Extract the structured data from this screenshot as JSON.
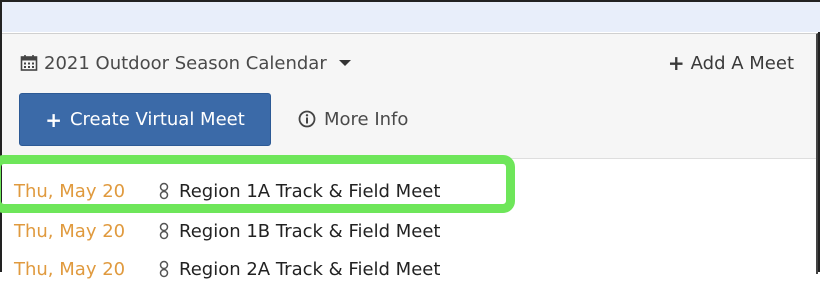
{
  "header": {
    "season_label": "2021 Outdoor Season Calendar",
    "add_meet_label": "Add A Meet",
    "create_button_label": "Create Virtual Meet",
    "more_info_label": "More Info"
  },
  "meets": [
    {
      "date": "Thu, May 20",
      "name": "Region 1A Track & Field Meet"
    },
    {
      "date": "Thu, May 20",
      "name": "Region 1B Track & Field Meet"
    },
    {
      "date": "Thu, May 20",
      "name": "Region 2A Track & Field Meet"
    }
  ],
  "colors": {
    "accent_button": "#3b6aa8",
    "date_text": "#e09a3e",
    "highlight_box": "#6ee65a"
  },
  "icons": {
    "calendar": "calendar-icon",
    "dropdown": "caret-down-icon",
    "plus": "plus-icon",
    "info": "info-circle-icon",
    "meet": "link-icon"
  }
}
